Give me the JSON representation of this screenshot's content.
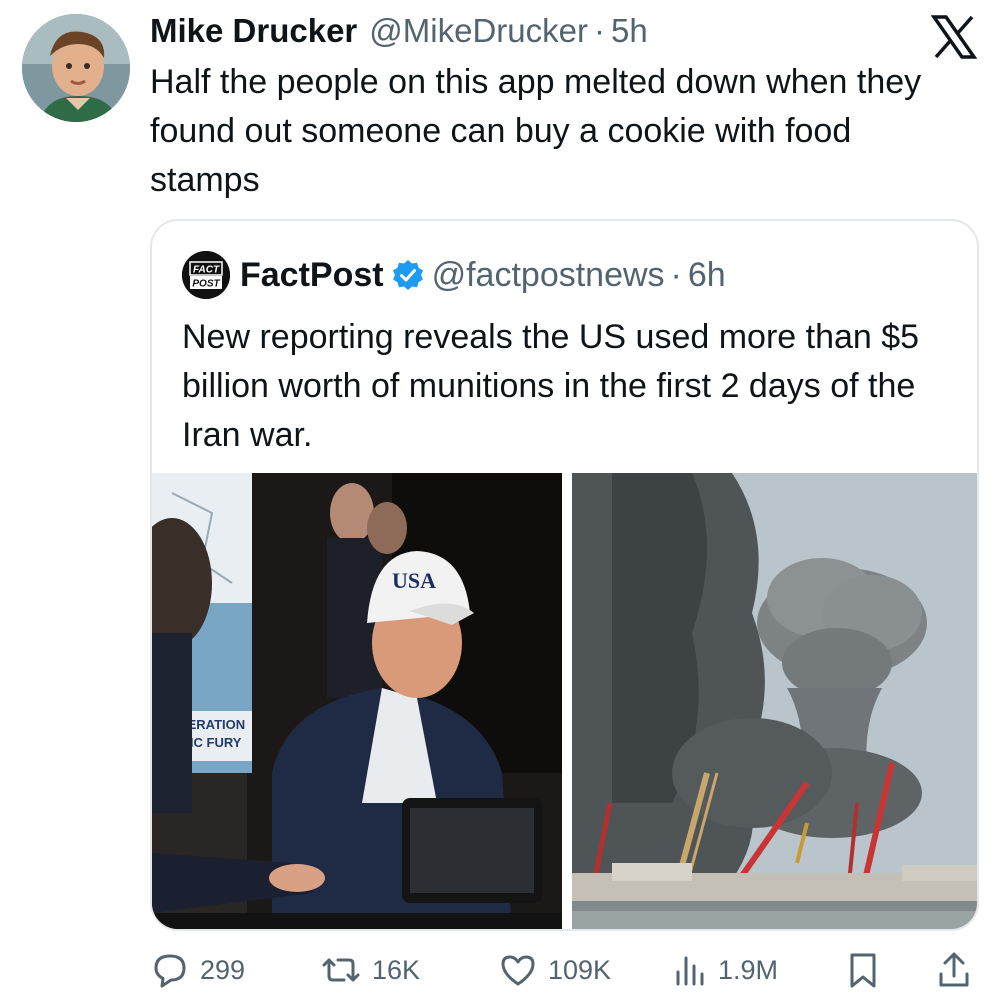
{
  "tweet": {
    "author_name": "Mike Drucker",
    "author_handle": "@MikeDrucker",
    "separator": "·",
    "time": "5h",
    "text": "Half the people on this app melted down when they found out someone can buy a cookie with food stamps"
  },
  "quoted_tweet": {
    "author_name": "FactPost",
    "author_handle": "@factpostnews",
    "separator": "·",
    "time": "6h",
    "verified": true,
    "avatar_text_line1": "FACT",
    "avatar_text_line2": "POST",
    "text": "New reporting reveals the US used more than $5 billion worth of munitions in the first 2 days of the Iran war.",
    "media": {
      "left": {
        "cap_text": "USA",
        "sign_line1": "OPERATION",
        "sign_line2": "EPIC FURY"
      },
      "right": {
        "description_icon": "smoke-plume-image"
      }
    }
  },
  "actions": {
    "replies": "299",
    "reposts": "16K",
    "likes": "109K",
    "views": "1.9M"
  },
  "icons": {
    "platform_logo": "x-logo",
    "reply": "speech-bubble-icon",
    "repost": "repost-arrows-icon",
    "like": "heart-icon",
    "views": "bar-chart-icon",
    "bookmark": "bookmark-icon",
    "share": "share-icon",
    "verified": "verified-badge-icon"
  },
  "colors": {
    "text": "#0f1419",
    "secondary": "#536471",
    "verified_blue": "#1d9bf0",
    "border": "#e5e8eb"
  }
}
